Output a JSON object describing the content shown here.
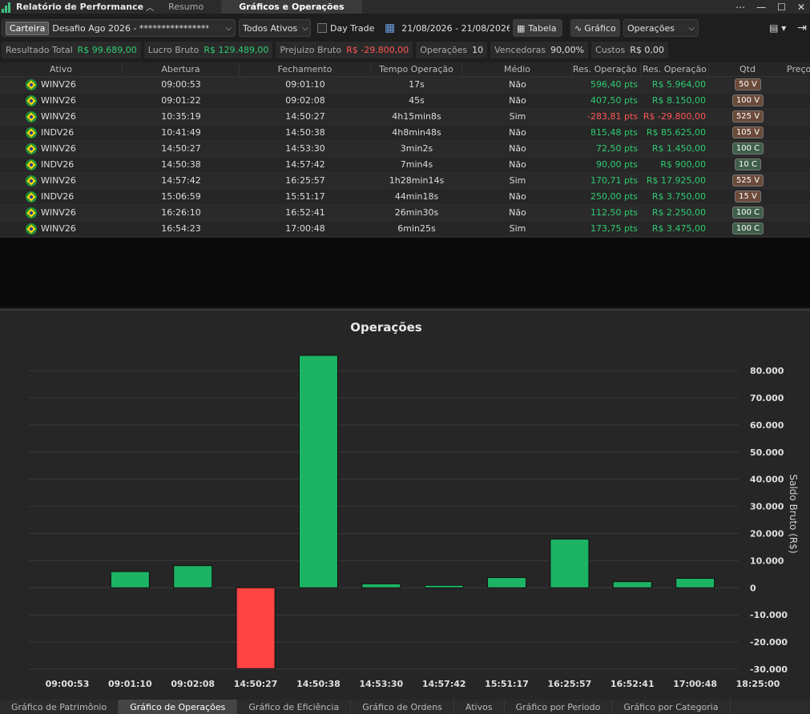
{
  "titlebar": {
    "app_title": "Relatório de Performance",
    "tabs": [
      {
        "label": "Resumo"
      },
      {
        "label": "Gráficos e Operações"
      }
    ]
  },
  "toolbar": {
    "carteira_label": "Carteira",
    "portfolio_value": "Desafio Ago 2026 - ****************...",
    "assets_filter": "Todos Ativos",
    "daytrade_label": "Day Trade",
    "date_range": "21/08/2026 - 21/08/2026",
    "tabela_label": "Tabela",
    "grafico_label": "Gráfico",
    "chart_select": "Operações"
  },
  "stats": [
    {
      "label": "Resultado Total",
      "value": "R$ 99.689,00",
      "color": "green"
    },
    {
      "label": "Lucro Bruto",
      "value": "R$ 129.489,00",
      "color": "green"
    },
    {
      "label": "Prejuizo Bruto",
      "value": "R$ -29.800,00",
      "color": "red"
    },
    {
      "label": "Operações",
      "value": "10",
      "color": ""
    },
    {
      "label": "Vencedoras",
      "value": "90,00%",
      "color": ""
    },
    {
      "label": "Custos",
      "value": "R$ 0,00",
      "color": ""
    }
  ],
  "table": {
    "headers": [
      "Ativo",
      "Abertura",
      "Fechamento",
      "Tempo Operação",
      "Médio",
      "Res. Operação (",
      "Res. Operação",
      "Qtd",
      "Preço"
    ],
    "rows": [
      {
        "ativo": "WINV26",
        "abertura": "09:00:53",
        "fechamento": "09:01:10",
        "tempo": "17s",
        "medio": "Não",
        "pts": "596,40 pts",
        "rs": "R$ 5.964,00",
        "qtd": "50 V",
        "side": "v",
        "neg": false
      },
      {
        "ativo": "WINV26",
        "abertura": "09:01:22",
        "fechamento": "09:02:08",
        "tempo": "45s",
        "medio": "Não",
        "pts": "407,50 pts",
        "rs": "R$ 8.150,00",
        "qtd": "100 V",
        "side": "v",
        "neg": false
      },
      {
        "ativo": "WINV26",
        "abertura": "10:35:19",
        "fechamento": "14:50:27",
        "tempo": "4h15min8s",
        "medio": "Sim",
        "pts": "-283,81 pts",
        "rs": "R$ -29.800,00",
        "qtd": "525 V",
        "side": "v",
        "neg": true
      },
      {
        "ativo": "INDV26",
        "abertura": "10:41:49",
        "fechamento": "14:50:38",
        "tempo": "4h8min48s",
        "medio": "Não",
        "pts": "815,48 pts",
        "rs": "R$ 85.625,00",
        "qtd": "105 V",
        "side": "v",
        "neg": false
      },
      {
        "ativo": "WINV26",
        "abertura": "14:50:27",
        "fechamento": "14:53:30",
        "tempo": "3min2s",
        "medio": "Não",
        "pts": "72,50 pts",
        "rs": "R$ 1.450,00",
        "qtd": "100 C",
        "side": "c",
        "neg": false
      },
      {
        "ativo": "INDV26",
        "abertura": "14:50:38",
        "fechamento": "14:57:42",
        "tempo": "7min4s",
        "medio": "Não",
        "pts": "90,00 pts",
        "rs": "R$ 900,00",
        "qtd": "10 C",
        "side": "c",
        "neg": false
      },
      {
        "ativo": "WINV26",
        "abertura": "14:57:42",
        "fechamento": "16:25:57",
        "tempo": "1h28min14s",
        "medio": "Sim",
        "pts": "170,71 pts",
        "rs": "R$ 17.925,00",
        "qtd": "525 V",
        "side": "v",
        "neg": false
      },
      {
        "ativo": "INDV26",
        "abertura": "15:06:59",
        "fechamento": "15:51:17",
        "tempo": "44min18s",
        "medio": "Não",
        "pts": "250,00 pts",
        "rs": "R$ 3.750,00",
        "qtd": "15 V",
        "side": "v",
        "neg": false
      },
      {
        "ativo": "WINV26",
        "abertura": "16:26:10",
        "fechamento": "16:52:41",
        "tempo": "26min30s",
        "medio": "Não",
        "pts": "112,50 pts",
        "rs": "R$ 2.250,00",
        "qtd": "100 C",
        "side": "c",
        "neg": false
      },
      {
        "ativo": "WINV26",
        "abertura": "16:54:23",
        "fechamento": "17:00:48",
        "tempo": "6min25s",
        "medio": "Sim",
        "pts": "173,75 pts",
        "rs": "R$ 3.475,00",
        "qtd": "100 C",
        "side": "c",
        "neg": false
      }
    ]
  },
  "chart_data": {
    "type": "bar",
    "title": "Operações",
    "ylabel": "Saldo Bruto (R$)",
    "xlabel": "",
    "categories": [
      "09:01:10",
      "09:02:08",
      "14:50:27",
      "14:50:38",
      "14:53:30",
      "14:57:42",
      "15:51:17",
      "16:25:57",
      "16:52:41",
      "17:00:48"
    ],
    "x_tick_labels": [
      "09:00:53",
      "09:01:10",
      "09:02:08",
      "14:50:27",
      "14:50:38",
      "14:53:30",
      "14:57:42",
      "15:51:17",
      "16:25:57",
      "16:52:41",
      "17:00:48",
      "18:25:00"
    ],
    "values": [
      5964,
      8150,
      -29800,
      85625,
      1450,
      900,
      3750,
      17925,
      2250,
      3475
    ],
    "y_ticks": [
      "80.000",
      "70.000",
      "60.000",
      "50.000",
      "40.000",
      "30.000",
      "20.000",
      "10.000",
      "0",
      "-10.000",
      "-20.000",
      "-30.000"
    ],
    "ylim": [
      -30000,
      85625
    ],
    "grid": true,
    "colors": {
      "positive": "#1db364",
      "negative": "#ff4444",
      "grid": "#3a3a3a"
    }
  },
  "bottom_tabs": [
    {
      "label": "Gráfico de Patrimônio"
    },
    {
      "label": "Gráfico de Operações"
    },
    {
      "label": "Gráfico de Eficiência"
    },
    {
      "label": "Gráfico de Ordens"
    },
    {
      "label": "Ativos"
    },
    {
      "label": "Gráfico por Periodo"
    },
    {
      "label": "Gráfico por Categoria"
    }
  ]
}
